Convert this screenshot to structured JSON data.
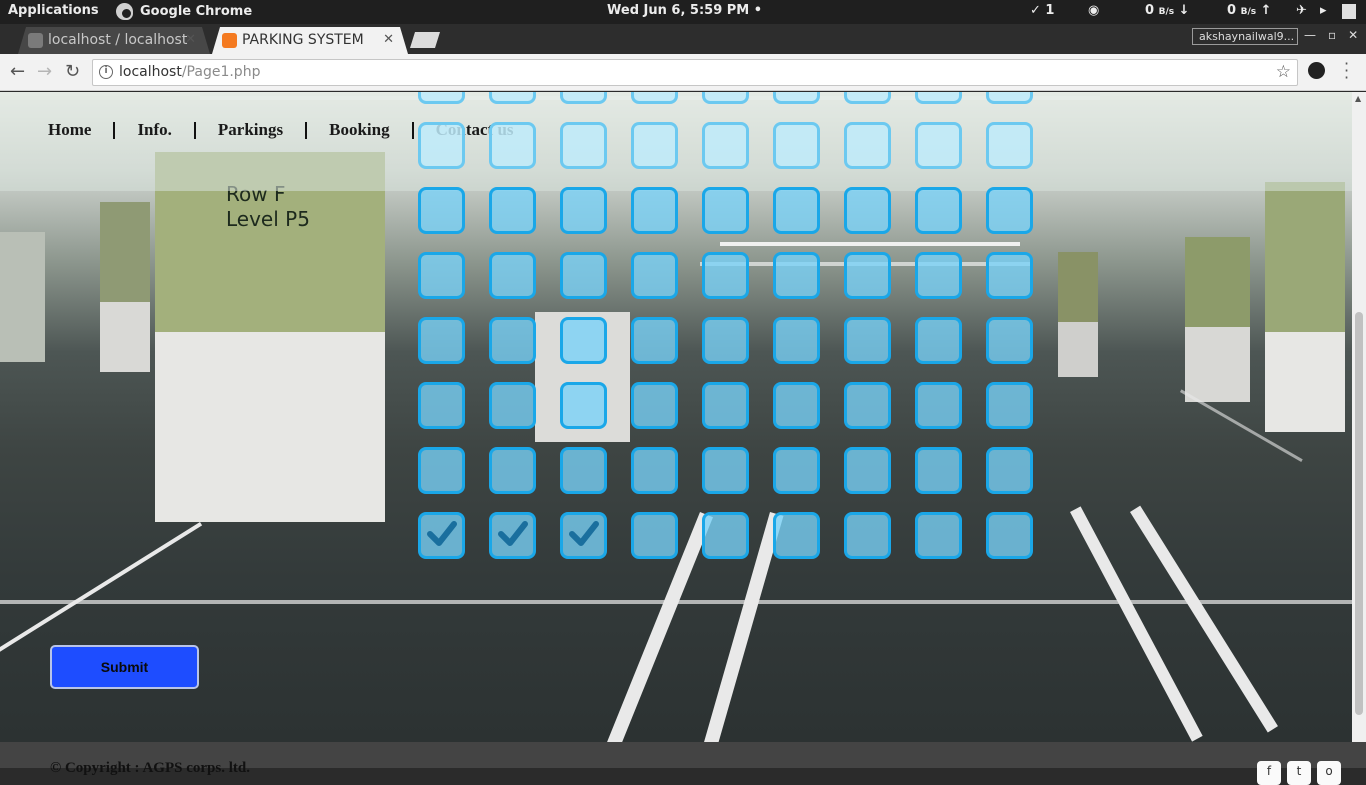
{
  "os_bar": {
    "applications": "Applications",
    "active_app": "Google Chrome",
    "clock": "Wed Jun  6,  5:59 PM •",
    "updates": "✓ 1",
    "download_speed": "0",
    "upload_speed": "0",
    "speed_unit": "B/s"
  },
  "browser": {
    "tabs": [
      {
        "title": "localhost / localhost",
        "favicon": "phpmyadmin-icon",
        "active": false
      },
      {
        "title": "PARKING SYSTEM",
        "favicon": "xampp-icon",
        "active": true
      }
    ],
    "profile": "akshaynailwal9...",
    "address": {
      "host": "localhost",
      "path": "/Page1.php"
    }
  },
  "page": {
    "nav": [
      "Home",
      "Info.",
      "Parkings",
      "Booking",
      "Contact us"
    ],
    "background_sign": [
      "Row F",
      "Level  P5"
    ],
    "grid": {
      "columns": 9,
      "rows": 8,
      "partial_top_row": true,
      "checked": [
        [
          7,
          0
        ],
        [
          7,
          1
        ],
        [
          7,
          2
        ]
      ]
    },
    "submit_label": "Submit",
    "footer": "© Copyright : AGPS corps. ltd."
  },
  "colors": {
    "slot_border": "#1aa7e8",
    "slot_fill": "#78d2f8",
    "submit": "#1e4dff",
    "check": "#1a6f9e"
  }
}
